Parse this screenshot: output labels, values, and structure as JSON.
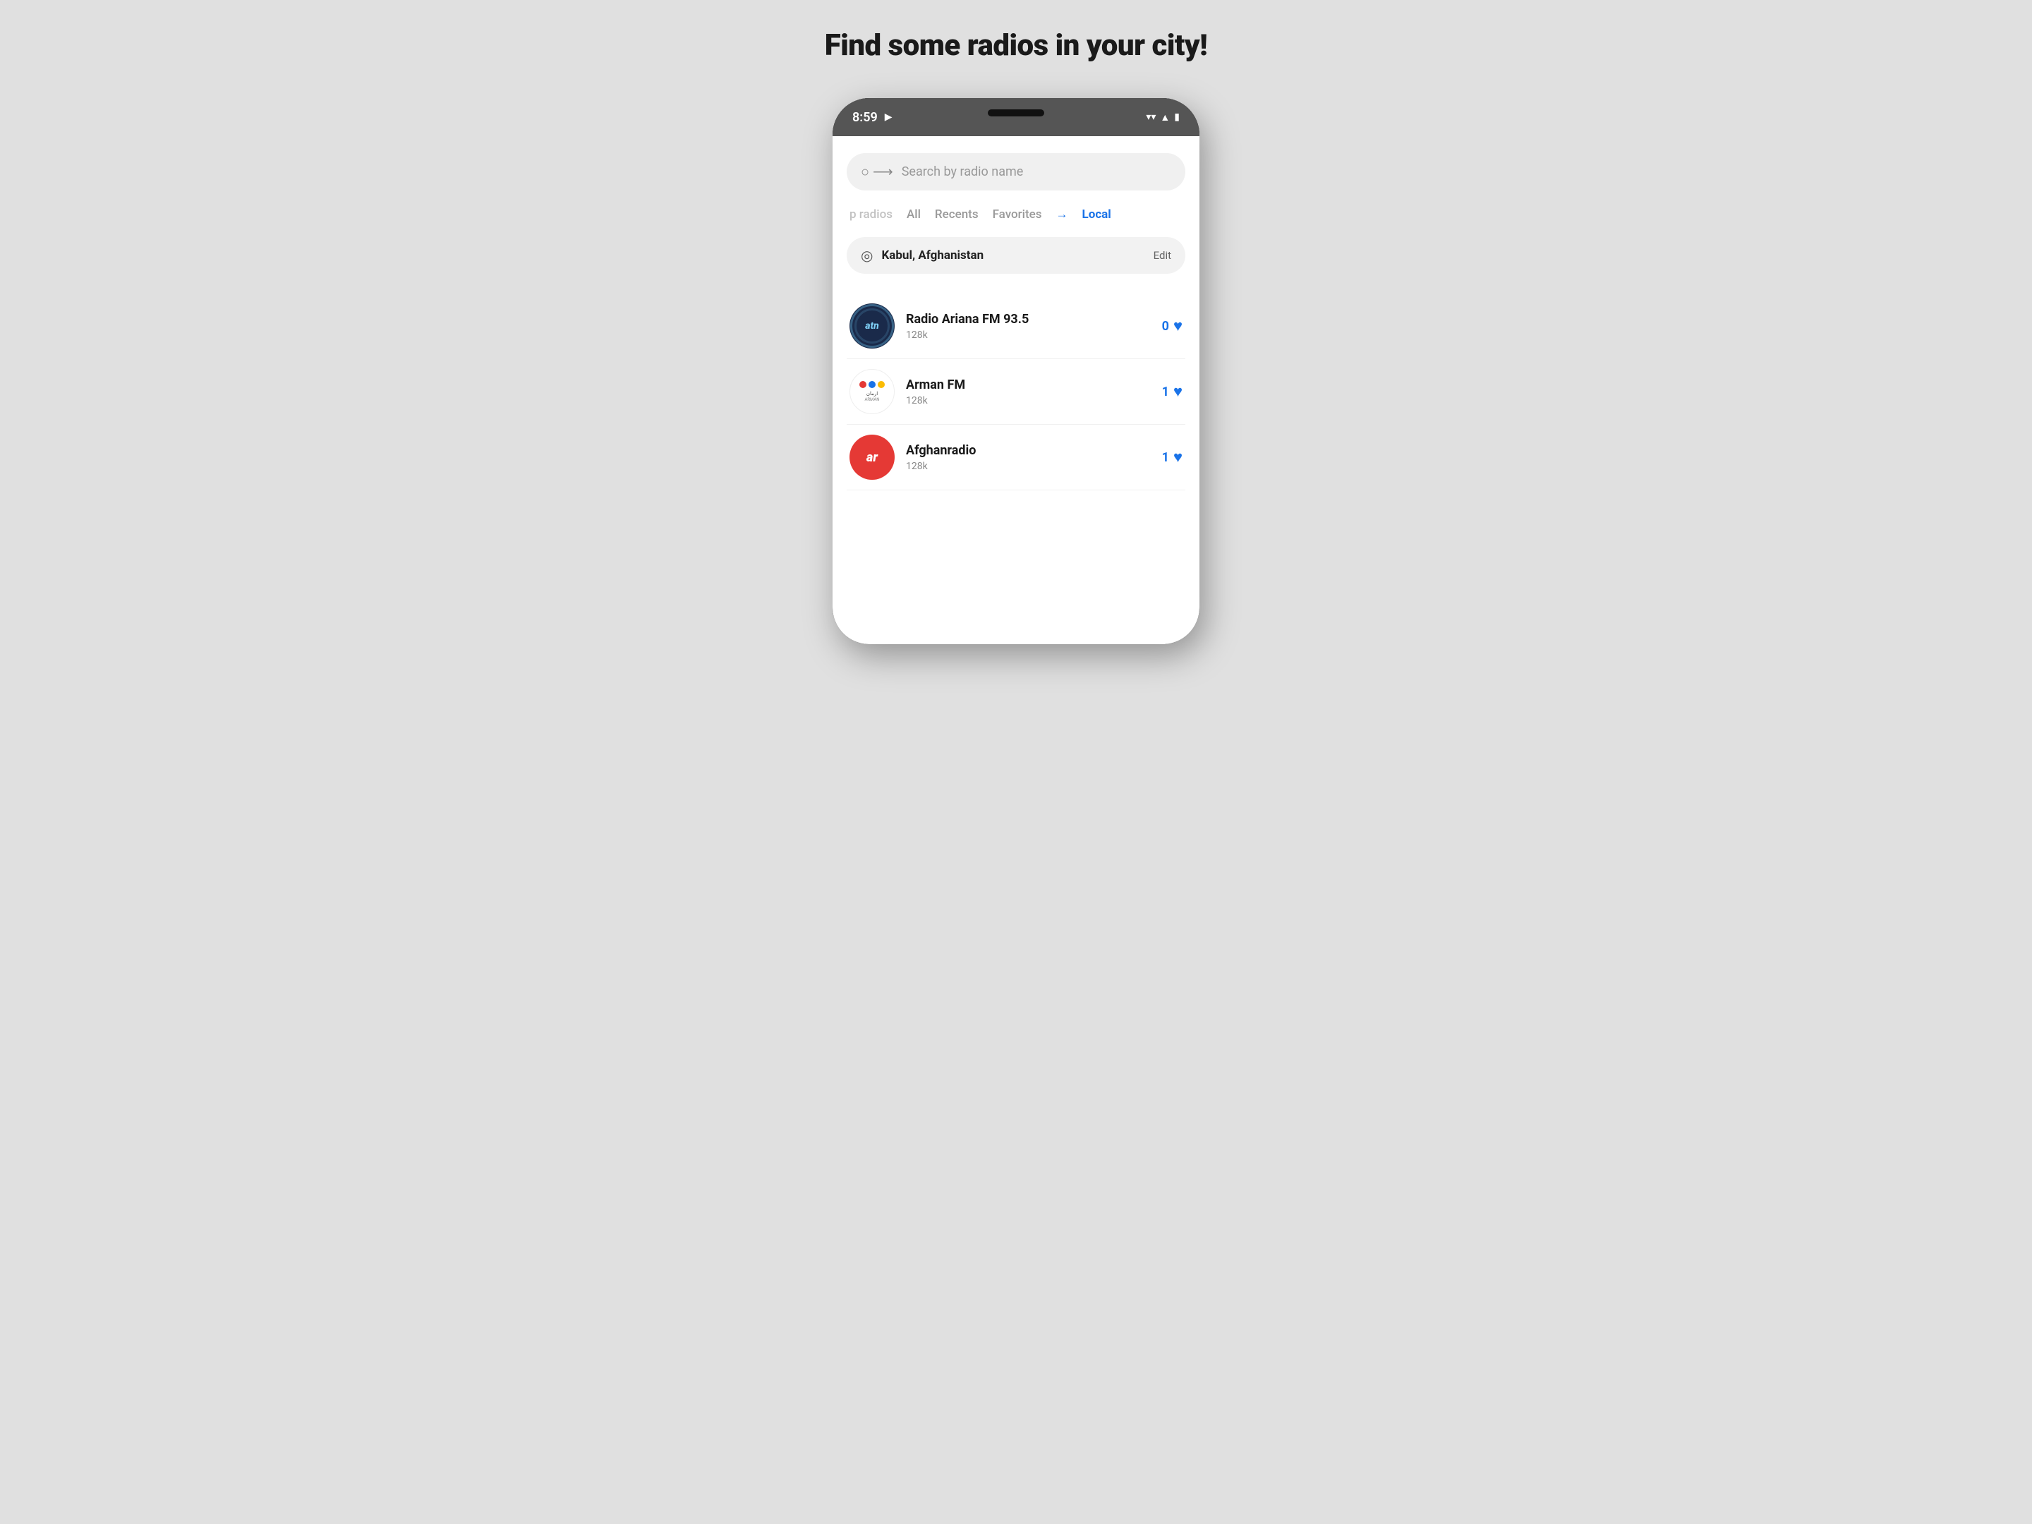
{
  "page": {
    "title": "Find some radios in your city!",
    "background_color": "#e0e0e0"
  },
  "status_bar": {
    "time": "8:59",
    "has_play": true
  },
  "search": {
    "placeholder": "Search by radio name"
  },
  "nav_tabs": [
    {
      "label": "p radios",
      "active": false,
      "partial": true
    },
    {
      "label": "All",
      "active": false
    },
    {
      "label": "Recents",
      "active": false
    },
    {
      "label": "Favorites",
      "active": false
    },
    {
      "label": "Local",
      "active": true
    }
  ],
  "location": {
    "name": "Kabul, Afghanistan",
    "edit_label": "Edit"
  },
  "radio_items": [
    {
      "name": "Radio Ariana FM 93.5",
      "bitrate": "128k",
      "favorites": "0",
      "logo_type": "ariana"
    },
    {
      "name": "Arman FM",
      "bitrate": "128k",
      "favorites": "1",
      "logo_type": "arman"
    },
    {
      "name": "Afghanradio",
      "bitrate": "128k",
      "favorites": "1",
      "logo_type": "afghan"
    }
  ],
  "icons": {
    "search": "🔍",
    "location_pin": "📍",
    "heart": "♥",
    "wifi": "▼",
    "play_triangle": "▶"
  }
}
